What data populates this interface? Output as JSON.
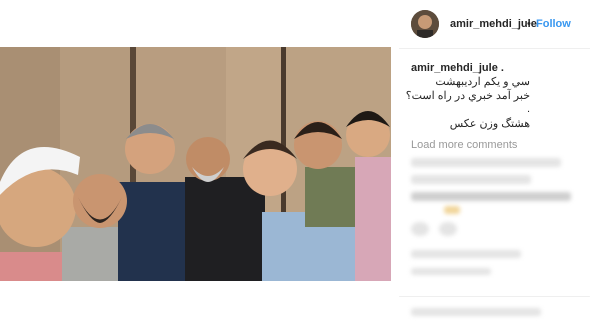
{
  "post": {
    "image_alt": "Group selfie of eight men in a wood-paneled room"
  },
  "header": {
    "username": "amir_mehdi_jule",
    "separator": "•",
    "follow_label": "Follow"
  },
  "caption": {
    "username": "amir_mehdi_jule .",
    "lines": [
      "سي و يکم ارديبهشت",
      "خبر آمد خبري در راه است؟",
      ".",
      "هشتگ وزن عکس"
    ]
  },
  "comments": {
    "load_more_label": "Load more comments"
  },
  "colors": {
    "accent": "#3897f0",
    "text": "#262626",
    "muted": "#999999"
  }
}
